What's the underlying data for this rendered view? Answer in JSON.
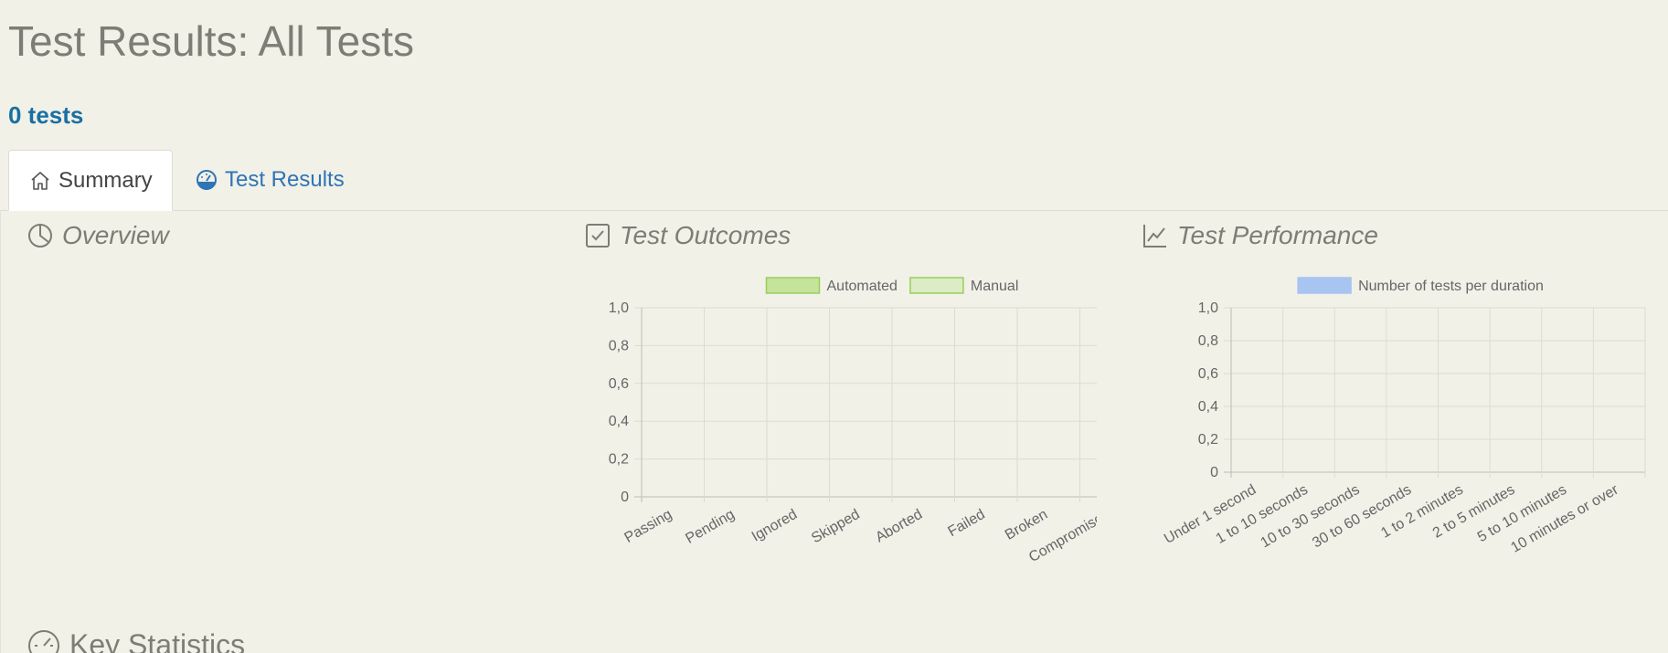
{
  "page": {
    "title": "Test Results: All Tests",
    "test_count": "0 tests"
  },
  "tabs": [
    {
      "label": "Summary",
      "icon": "home-icon",
      "active": true
    },
    {
      "label": "Test Results",
      "icon": "dashboard-icon",
      "active": false
    }
  ],
  "sections": {
    "overview": {
      "title": "Overview",
      "icon": "pie-chart-icon"
    },
    "outcomes": {
      "title": "Test Outcomes",
      "icon": "checkbox-icon"
    },
    "performance": {
      "title": "Test Performance",
      "icon": "line-chart-icon"
    },
    "key_statistics": {
      "title": "Key Statistics",
      "icon": "speedometer-icon"
    }
  },
  "colors": {
    "automated": "#c5e39a",
    "automated_border": "#9acd5c",
    "manual": "#dcecc4",
    "manual_border": "#9acd5c",
    "duration": "#a8c4f0",
    "grid": "#dcdcd2",
    "axis_text": "#666666",
    "link": "#2f74b5",
    "count": "#1a6fa3"
  },
  "chart_data": [
    {
      "type": "bar",
      "id": "outcomes",
      "categories": [
        "Passing",
        "Pending",
        "Ignored",
        "Skipped",
        "Aborted",
        "Failed",
        "Broken",
        "Compromised"
      ],
      "series": [
        {
          "name": "Automated",
          "values": [
            0,
            0,
            0,
            0,
            0,
            0,
            0,
            0
          ]
        },
        {
          "name": "Manual",
          "values": [
            0,
            0,
            0,
            0,
            0,
            0,
            0,
            0
          ]
        }
      ],
      "yticks": [
        "0",
        "0,2",
        "0,4",
        "0,6",
        "0,8",
        "1,0"
      ],
      "ylim": [
        0,
        1
      ],
      "legend": "top-center",
      "grid": true
    },
    {
      "type": "bar",
      "id": "performance",
      "categories": [
        "Under 1 second",
        "1 to 10 seconds",
        "10 to 30 seconds",
        "30 to 60 seconds",
        "1 to 2 minutes",
        "2 to 5 minutes",
        "5 to 10 minutes",
        "10 minutes or over"
      ],
      "series": [
        {
          "name": "Number of tests per duration",
          "values": [
            0,
            0,
            0,
            0,
            0,
            0,
            0,
            0
          ]
        }
      ],
      "yticks": [
        "0",
        "0,2",
        "0,4",
        "0,6",
        "0,8",
        "1,0"
      ],
      "ylim": [
        0,
        1
      ],
      "legend": "top-center",
      "grid": true
    }
  ]
}
